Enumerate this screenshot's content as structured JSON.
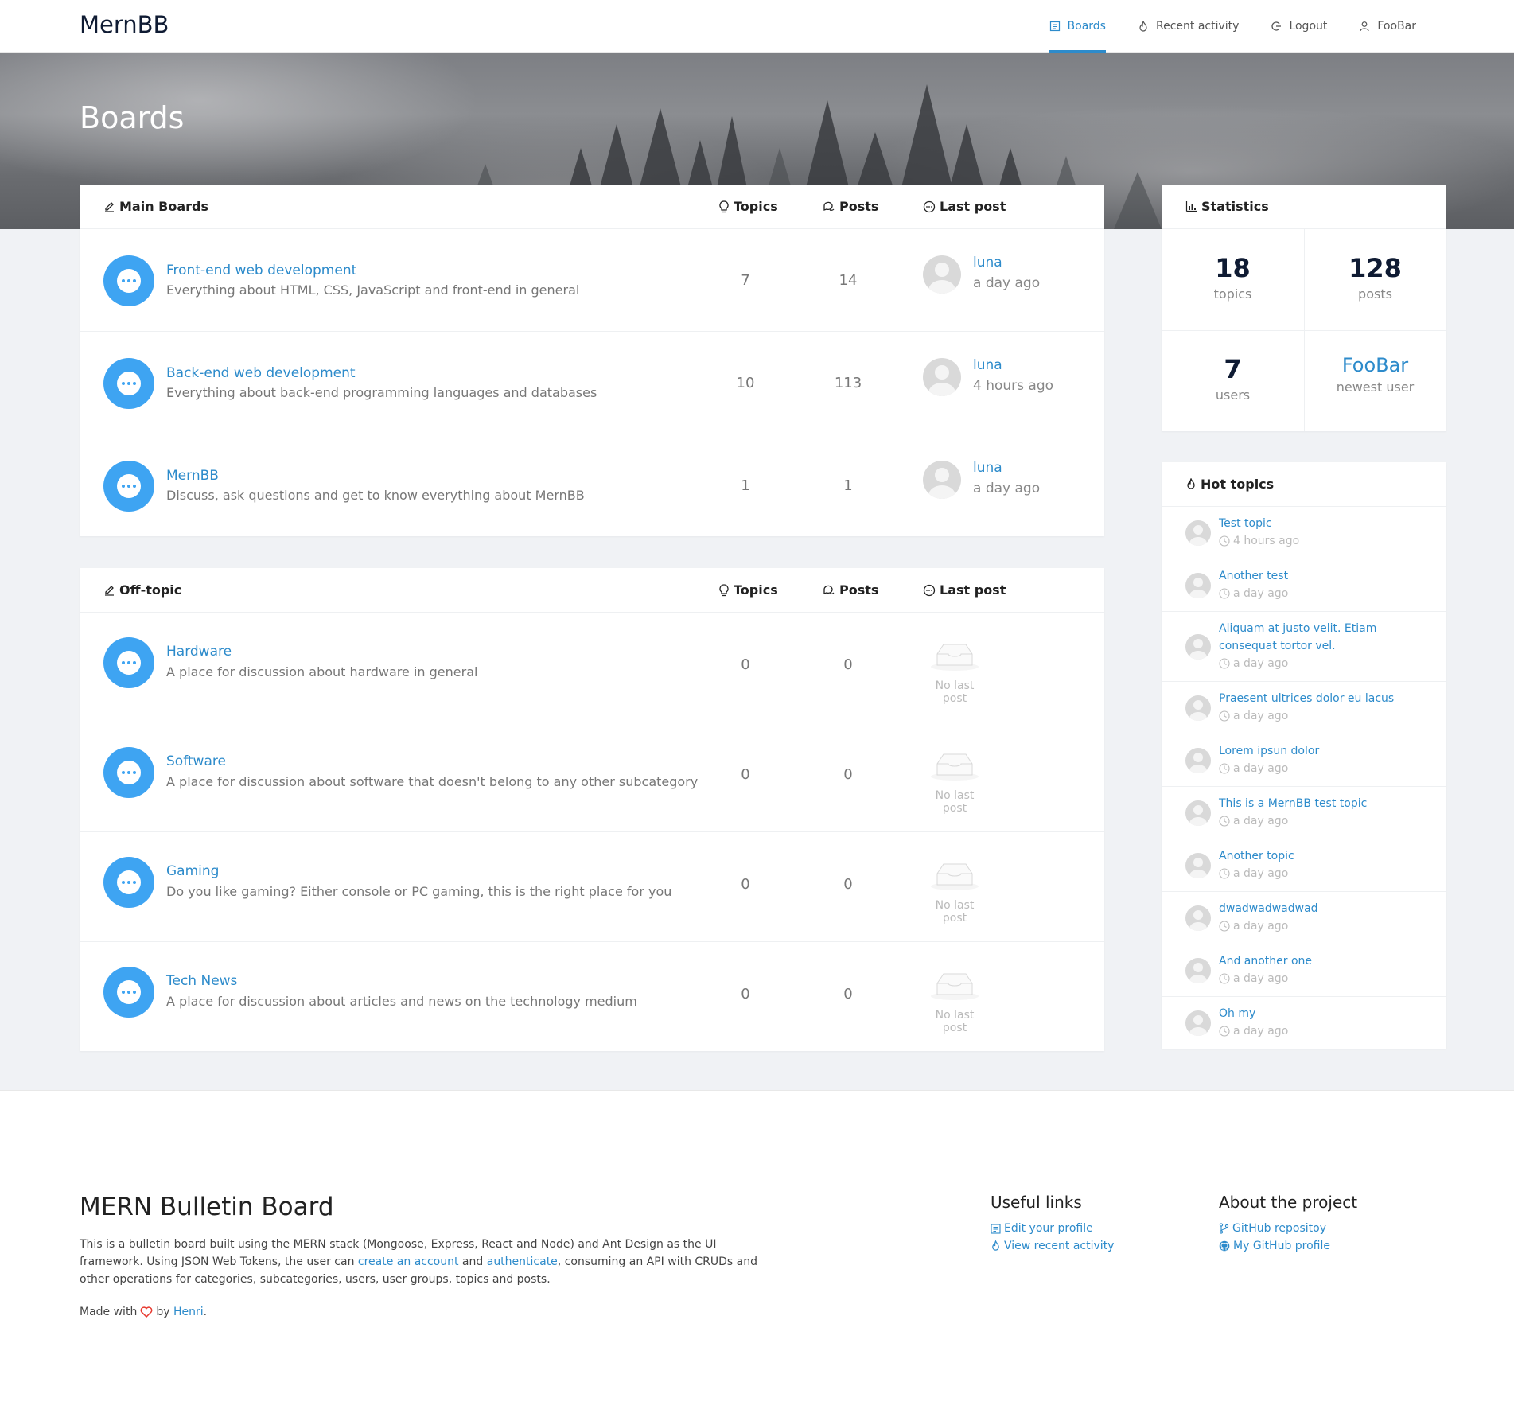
{
  "header": {
    "brand": "MernBB",
    "nav": [
      {
        "label": "Boards",
        "icon": "boards-icon",
        "active": true
      },
      {
        "label": "Recent activity",
        "icon": "fire-icon"
      },
      {
        "label": "Logout",
        "icon": "logout-icon"
      },
      {
        "label": "FooBar",
        "icon": "user-icon"
      }
    ]
  },
  "hero": {
    "title": "Boards"
  },
  "categories": [
    {
      "name": "Main Boards",
      "col_topics": "Topics",
      "col_posts": "Posts",
      "col_last": "Last post",
      "boards": [
        {
          "title": "Front-end web development",
          "desc": "Everything about HTML, CSS, JavaScript and front-end in general",
          "topics": "7",
          "posts": "14",
          "last_user": "luna",
          "last_time": "a day ago"
        },
        {
          "title": "Back-end web development",
          "desc": "Everything about back-end programming languages and databases",
          "topics": "10",
          "posts": "113",
          "last_user": "luna",
          "last_time": "4 hours ago"
        },
        {
          "title": "MernBB",
          "desc": "Discuss, ask questions and get to know everything about MernBB",
          "topics": "1",
          "posts": "1",
          "last_user": "luna",
          "last_time": "a day ago"
        }
      ]
    },
    {
      "name": "Off-topic",
      "col_topics": "Topics",
      "col_posts": "Posts",
      "col_last": "Last post",
      "boards": [
        {
          "title": "Hardware",
          "desc": "A place for discussion about hardware in general",
          "topics": "0",
          "posts": "0",
          "no_last": "No last post"
        },
        {
          "title": "Software",
          "desc": "A place for discussion about software that doesn't belong to any other subcategory",
          "topics": "0",
          "posts": "0",
          "no_last": "No last post"
        },
        {
          "title": "Gaming",
          "desc": "Do you like gaming? Either console or PC gaming, this is the right place for you",
          "topics": "0",
          "posts": "0",
          "no_last": "No last post"
        },
        {
          "title": "Tech News",
          "desc": "A place for discussion about articles and news on the technology medium",
          "topics": "0",
          "posts": "0",
          "no_last": "No last post"
        }
      ]
    }
  ],
  "statistics": {
    "title": "Statistics",
    "topics_n": "18",
    "topics_l": "topics",
    "posts_n": "128",
    "posts_l": "posts",
    "users_n": "7",
    "users_l": "users",
    "newest_n": "FooBar",
    "newest_l": "newest user"
  },
  "hot_topics": {
    "title": "Hot topics",
    "items": [
      {
        "title": "Test topic",
        "time": "4 hours ago"
      },
      {
        "title": "Another test",
        "time": "a day ago"
      },
      {
        "title": "Aliquam at justo velit. Etiam consequat tortor vel.",
        "time": "a day ago"
      },
      {
        "title": "Praesent ultrices dolor eu lacus",
        "time": "a day ago"
      },
      {
        "title": "Lorem ipsun dolor",
        "time": "a day ago"
      },
      {
        "title": "This is a MernBB test topic",
        "time": "a day ago"
      },
      {
        "title": "Another topic",
        "time": "a day ago"
      },
      {
        "title": "dwadwadwadwad",
        "time": "a day ago"
      },
      {
        "title": "And another one",
        "time": "a day ago"
      },
      {
        "title": "Oh my",
        "time": "a day ago"
      }
    ]
  },
  "footer": {
    "title": "MERN Bulletin Board",
    "text_1": "This is a bulletin board built using the MERN stack (Mongoose, Express, React and Node) and Ant Design as the UI framework. Using JSON Web Tokens, the user can ",
    "link_create": "create an account",
    "text_2": " and ",
    "link_auth": "authenticate",
    "text_3": ", consuming an API with CRUDs and other operations for categories, subcategories, users, user groups, topics and posts.",
    "made_with": "Made with",
    "by": "by",
    "author": "Henri",
    "period": ".",
    "useful_title": "Useful links",
    "useful": [
      "Edit your profile",
      "View recent activity"
    ],
    "about_title": "About the project",
    "about": [
      "GitHub repositoy",
      "My GitHub profile"
    ]
  },
  "colors": {
    "accent": "#2d8bcb",
    "bubble": "#3ea4f2",
    "heart": "#e8392f"
  }
}
